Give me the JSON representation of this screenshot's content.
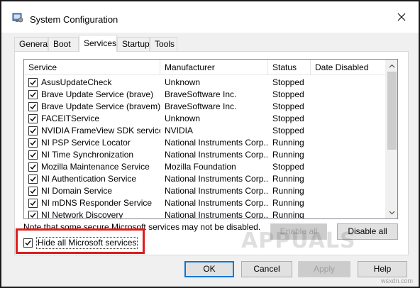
{
  "window": {
    "title": "System Configuration"
  },
  "tabs": [
    {
      "label": "General"
    },
    {
      "label": "Boot"
    },
    {
      "label": "Services"
    },
    {
      "label": "Startup"
    },
    {
      "label": "Tools"
    }
  ],
  "table": {
    "columns": [
      "Service",
      "Manufacturer",
      "Status",
      "Date Disabled"
    ],
    "rows": [
      {
        "service": "AsusUpdateCheck",
        "manufacturer": "Unknown",
        "status": "Stopped",
        "date": ""
      },
      {
        "service": "Brave Update Service (brave)",
        "manufacturer": "BraveSoftware Inc.",
        "status": "Stopped",
        "date": ""
      },
      {
        "service": "Brave Update Service (bravem)",
        "manufacturer": "BraveSoftware Inc.",
        "status": "Stopped",
        "date": ""
      },
      {
        "service": "FACEITService",
        "manufacturer": "Unknown",
        "status": "Stopped",
        "date": ""
      },
      {
        "service": "NVIDIA FrameView SDK service",
        "manufacturer": "NVIDIA",
        "status": "Stopped",
        "date": ""
      },
      {
        "service": "NI PSP Service Locator",
        "manufacturer": "National Instruments Corp...",
        "status": "Running",
        "date": ""
      },
      {
        "service": "NI Time Synchronization",
        "manufacturer": "National Instruments Corp...",
        "status": "Running",
        "date": ""
      },
      {
        "service": "Mozilla Maintenance Service",
        "manufacturer": "Mozilla Foundation",
        "status": "Stopped",
        "date": ""
      },
      {
        "service": "NI Authentication Service",
        "manufacturer": "National Instruments Corp...",
        "status": "Running",
        "date": ""
      },
      {
        "service": "NI Domain Service",
        "manufacturer": "National Instruments Corp...",
        "status": "Running",
        "date": ""
      },
      {
        "service": "NI mDNS Responder Service",
        "manufacturer": "National Instruments Corp...",
        "status": "Running",
        "date": ""
      },
      {
        "service": "NI Network Discovery",
        "manufacturer": "National Instruments Corp...",
        "status": "Running",
        "date": ""
      }
    ]
  },
  "note": "Note that some secure Microsoft services may not be disabled.",
  "buttons": {
    "enable_all": "Enable all",
    "disable_all": "Disable all",
    "ok": "OK",
    "cancel": "Cancel",
    "apply": "Apply",
    "help": "Help"
  },
  "hide_ms": {
    "label": "Hide all Microsoft services",
    "checked": true
  },
  "watermark": "APPUALS",
  "site": "wsxdn.com"
}
